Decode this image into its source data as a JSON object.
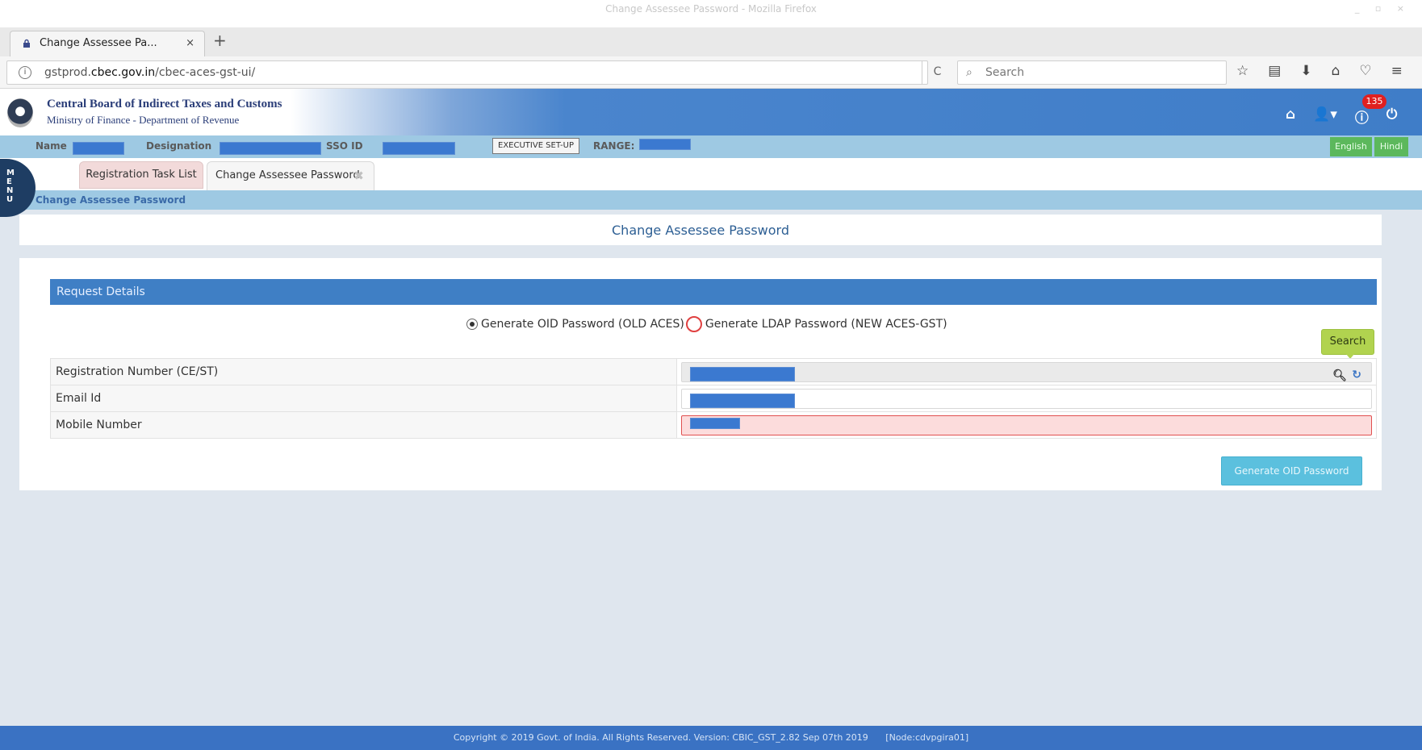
{
  "caption_text": "",
  "window": {
    "title": "Change Assessee Password - Mozilla Firefox",
    "controls": "_ ▫ ×"
  },
  "browser": {
    "tab_title": "Change Assessee Pa...",
    "tab_close": "×",
    "new_tab": "+",
    "url_prefix": "gstprod.",
    "url_host": "cbec.gov.in",
    "url_path": "/cbec-aces-gst-ui/",
    "reload": "C",
    "search_placeholder": "Search",
    "toolbar_icons": [
      "star-icon",
      "reading-list-icon",
      "download-icon",
      "home-icon",
      "pocket-icon",
      "hamburger-menu-icon"
    ]
  },
  "header": {
    "org_name": "Central Board of Indirect Taxes and Customs",
    "org_sub": "Ministry of Finance - Department of Revenue",
    "notifications": "135",
    "colors": {
      "header_blue": "#3f7dc8",
      "info_bar": "#9ec9e3",
      "accent_green": "#5cb85c"
    }
  },
  "info_bar": {
    "name_label": "Name",
    "designation_label": "Designation",
    "sso_label": "SSO ID",
    "exec_setup": "EXECUTIVE SET-UP",
    "range_label": "RANGE:",
    "lang_english": "English",
    "lang_hindi": "Hindi"
  },
  "app_tabs": {
    "menu_letters": [
      "M",
      "E",
      "N",
      "U"
    ],
    "task_list": "Registration Task List",
    "change_password": "Change Assessee Password",
    "close": "✖",
    "breadcrumb": "Change Assessee Password"
  },
  "main": {
    "page_title": "Change Assessee Password",
    "section_header": "Request Details",
    "radio_options": [
      {
        "label": "Generate OID Password (OLD ACES)",
        "checked": true
      },
      {
        "label": "Generate LDAP Password (NEW ACES-GST)",
        "checked": false
      }
    ],
    "search_button": "Search",
    "fields": [
      {
        "label": "Registration Number (CE/ST)",
        "value": ""
      },
      {
        "label": "Email Id",
        "value": ""
      },
      {
        "label": "Mobile Number",
        "value": ""
      }
    ],
    "generate_button": "Generate OID Password"
  },
  "footer": {
    "text": "Copyright © 2019 Govt. of India. All Rights Reserved. Version: CBIC_GST_2.82 Sep 07th 2019",
    "node": "[Node:cdvpgira01]"
  }
}
